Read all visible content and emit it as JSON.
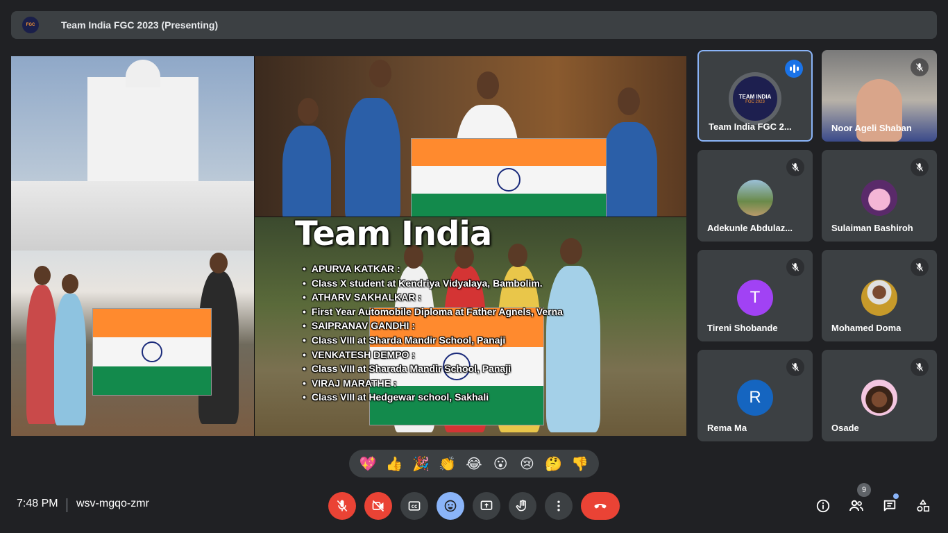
{
  "meeting": {
    "presenting_title": "Team India FGC 2023 (Presenting)",
    "time": "7:48 PM",
    "code": "wsv-mgqo-zmr",
    "participant_count": "9"
  },
  "slide": {
    "title": "Team India",
    "bullets": [
      "APURVA KATKAR :",
      "Class X student at Kendriya Vidyalaya, Bambolim.",
      "ATHARV SAKHALKAR :",
      "First Year Automobile Diploma at Father Agnels, Verna",
      "SAIPRANAV GANDHI :",
      "Class VIII at Sharda Mandir School, Panaji",
      "VENKATESH DEMPO :",
      "Class VIII at Sharada Mandir School, Panaji",
      "VIRAJ MARATHE :",
      "Class VIII at Hedgewar school, Sakhali"
    ]
  },
  "participants": [
    {
      "name": "Team India FGC 2023",
      "display": "Team India FGC 2...",
      "avatar_text": "TEAM INDIA",
      "avatar_subtext": "FGC 2023",
      "speaking": true
    },
    {
      "name": "Noor Ageli Shaban",
      "display": "Noor Ageli Shaban",
      "video": true
    },
    {
      "name": "Adekunle Abdulaziz",
      "display": "Adekunle Abdulaz...",
      "avatar_kind": "photo"
    },
    {
      "name": "Sulaiman Bashiroh",
      "display": "Sulaiman Bashiroh",
      "avatar_kind": "photo"
    },
    {
      "name": "Tireni Shobande",
      "display": "Tireni Shobande",
      "avatar_letter": "T",
      "avatar_color": "#a142f4"
    },
    {
      "name": "Mohamed Doma",
      "display": "Mohamed Doma",
      "avatar_kind": "photo"
    },
    {
      "name": "Rema Ma",
      "display": "Rema Ma",
      "avatar_letter": "R",
      "avatar_color": "#1565c0"
    },
    {
      "name": "Osade",
      "display": "Osade",
      "avatar_kind": "photo"
    }
  ],
  "reactions": [
    "💖",
    "👍",
    "🎉",
    "👏",
    "😂",
    "😮",
    "😢",
    "🤔",
    "👎"
  ],
  "controls": {
    "mic": "microphone-off",
    "camera": "camera-off",
    "captions": "CC",
    "emoji": "emoji",
    "present": "present-screen",
    "raise_hand": "raise-hand",
    "more": "more-options",
    "leave": "leave-call"
  },
  "colors": {
    "background": "#202124",
    "surface": "#3c4043",
    "danger": "#ea4335",
    "accent": "#8ab4f8"
  }
}
